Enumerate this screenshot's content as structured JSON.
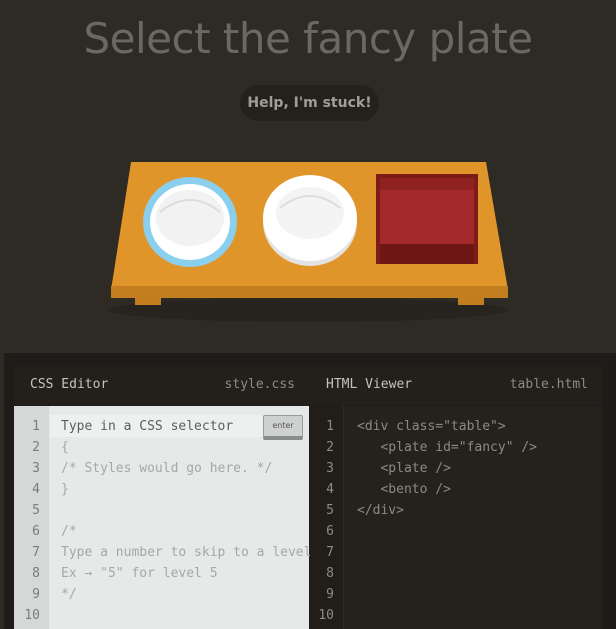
{
  "header": {
    "instruction": "Select the fancy plate",
    "help_label": "Help, I'm stuck!"
  },
  "table_items": [
    "plate-fancy",
    "plate",
    "bento"
  ],
  "colors": {
    "background": "#2e2a24",
    "table": "#e0952a",
    "fancy_ring": "#8fd3f4",
    "plate": "#ffffff",
    "bento": "#a12a28"
  },
  "css_editor": {
    "title": "CSS Editor",
    "file": "style.css",
    "input_placeholder": "Type in a CSS selector",
    "enter_label": "enter",
    "line_numbers": [
      "1",
      "2",
      "3",
      "4",
      "5",
      "6",
      "7",
      "8",
      "9",
      "10"
    ],
    "lines": [
      "{",
      "/* Styles would go here. */",
      "}",
      "",
      "/*",
      "Type a number to skip to a level.",
      "Ex → \"5\" for level 5",
      "*/"
    ]
  },
  "html_viewer": {
    "title": "HTML Viewer",
    "file": "table.html",
    "line_numbers": [
      "1",
      "2",
      "3",
      "4",
      "5",
      "6",
      "7",
      "8",
      "9",
      "10"
    ],
    "lines": [
      "<div class=\"table\">",
      "   <plate id=\"fancy\" />",
      "   <plate />",
      "   <bento />",
      "</div>"
    ]
  }
}
